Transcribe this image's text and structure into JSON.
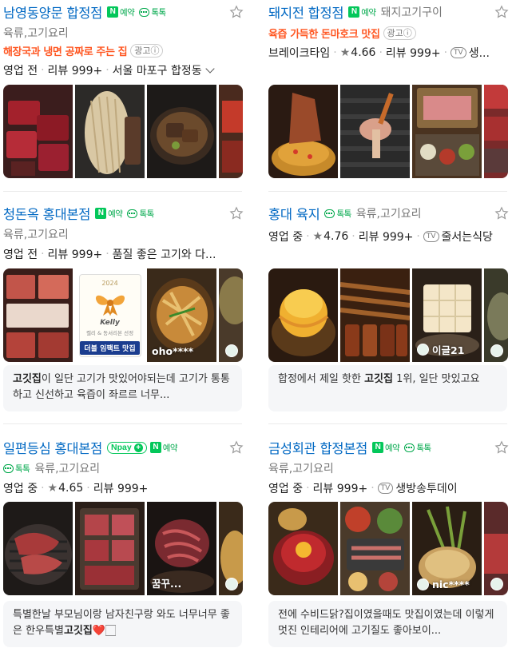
{
  "colors": {
    "name": "#0068c3",
    "naver_green": "#03c75a",
    "promo": "#ff5722"
  },
  "badges": {
    "reserve": "예약",
    "talk": "톡톡",
    "npay": "pay"
  },
  "ad_label": "광고",
  "cards": [
    {
      "name": "남영동양문 합정점",
      "badges": [
        "reserve",
        "talk"
      ],
      "category": "육류,고기요리",
      "promo": "해장국과 냉면 공짜로 주는 집",
      "ad": true,
      "meta": {
        "status": "영업 전",
        "review": "리뷰 999+",
        "location": "서울 마포구 합정동"
      },
      "photos": [
        {
          "tag": ""
        },
        {
          "tag": ""
        },
        {
          "tag": ""
        },
        {
          "tag": ""
        }
      ]
    },
    {
      "name": "돼지전 합정점",
      "badges": [
        "reserve"
      ],
      "category": "돼지고기구이",
      "promo": "육즙 가득한 돈마호크 맛집",
      "ad": true,
      "meta": {
        "status": "브레이크타임",
        "rating": "4.66",
        "review": "리뷰 999+",
        "tv": "TV",
        "extra": "생..."
      },
      "photos": [
        {
          "tag": ""
        },
        {
          "tag": ""
        },
        {
          "tag": ""
        },
        {
          "tag": ""
        }
      ]
    },
    {
      "name": "청돈옥 홍대본점",
      "badges": [
        "reserve",
        "talk"
      ],
      "category": "육류,고기요리",
      "meta": {
        "status": "영업 전",
        "review": "리뷰 999+",
        "extra": "품질 좋은 고기와 다..."
      },
      "photos": [
        {
          "tag": ""
        },
        {
          "kelly_year": "2024",
          "kelly_brand": "Kelly",
          "kelly_small": "켈리 & 동서리본 선정",
          "kelly_title": "더블 임팩트 맛집"
        },
        {
          "tag": "oho****"
        },
        {
          "tag": ""
        }
      ],
      "review": {
        "pre": "",
        "bold": "고깃집",
        "post": "이 일단 고기가 맛있어야되는데 고기가 통통하고 신선하고 육즙이 좌르르 너무..."
      }
    },
    {
      "name": "홍대 육지",
      "badges": [
        "talk"
      ],
      "category": "육류,고기요리",
      "meta": {
        "status": "영업 중",
        "rating": "4.76",
        "review": "리뷰 999+",
        "tv": "TV",
        "extra": "줄서는식당"
      },
      "photos": [
        {
          "tag": ""
        },
        {
          "tag": ""
        },
        {
          "tag": "이글21"
        },
        {
          "tag": ""
        }
      ],
      "review": {
        "pre": "합정에서 제일 핫한 ",
        "bold": "고깃집",
        "post": " 1위, 일단 맛있고요"
      }
    },
    {
      "name": "일편등심 홍대본점",
      "badges": [
        "npay",
        "reserve"
      ],
      "badges_line2": [
        "talk"
      ],
      "category": "육류,고기요리",
      "meta": {
        "status": "영업 중",
        "rating": "4.65",
        "review": "리뷰 999+"
      },
      "photos": [
        {
          "tag": ""
        },
        {
          "tag": ""
        },
        {
          "tag": "꿈꾸..."
        },
        {
          "tag": ""
        }
      ],
      "review": {
        "pre": "특별한날 부모님이랑 남자친구랑 와도 너무너무 좋은 한우특별",
        "bold": "고깃집",
        "post": "❤️🏻"
      }
    },
    {
      "name": "금성회관 합정본점",
      "badges": [
        "reserve",
        "talk"
      ],
      "category": "육류,고기요리",
      "meta": {
        "status": "영업 중",
        "review": "리뷰 999+",
        "tv": "TV",
        "extra": "생방송투데이"
      },
      "photos": [
        {
          "tag": ""
        },
        {
          "tag": ""
        },
        {
          "tag": "nic****"
        },
        {
          "tag": ""
        }
      ],
      "review": {
        "pre": "전에 수비드닭?집이였을때도 맛집이였는데 이렇게 멋진 인테리어에 고기질도 좋아보이...",
        "bold": "",
        "post": ""
      }
    }
  ]
}
